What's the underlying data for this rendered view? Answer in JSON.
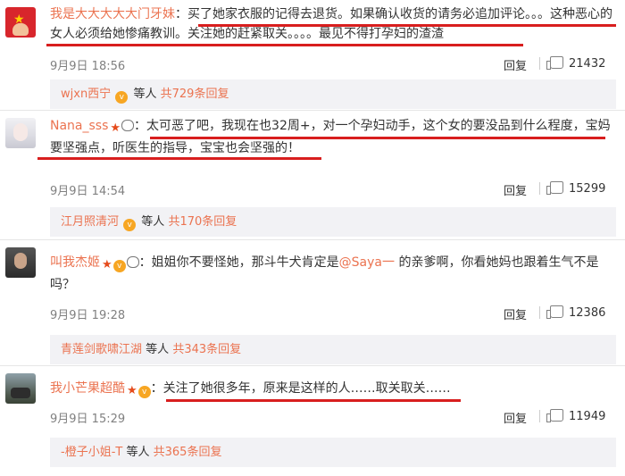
{
  "comments": [
    {
      "username": "我是大大大大大门牙妹",
      "separator": "：",
      "body": "买了她家衣服的记得去退货。如果确认收货的请务必追加评论。。。这种恶心的女人必须给她惨痛教训。关注她的赶紧取关。。。。最见不得打孕妇的渣渣",
      "date": "9月9日 18:56",
      "reply_label": "回复",
      "likes": "21432",
      "reply_preview": {
        "name": "wjxn西宁",
        "suffix": "等人",
        "more": "共729条回复"
      },
      "avatar_icon": "china-flag-avatar"
    },
    {
      "username": "Nana_sss",
      "separator": "：",
      "body": "太可恶了吧，我现在也32周+，对一个孕妇动手，这个女的要没品到什么程度，宝妈要坚强点，听医生的指导，宝宝也会坚强的！",
      "date": "9月9日 14:54",
      "reply_label": "回复",
      "likes": "15299",
      "reply_preview": {
        "name": "江月照清河",
        "suffix": "等人",
        "more": "共170条回复"
      },
      "avatar_icon": "girl-avatar"
    },
    {
      "username": "叫我杰姬",
      "separator": "：",
      "body_before": "姐姐你不要怪她，那斗牛犬肯定是",
      "mention": "@Saya一",
      "body_after": " 的亲爹啊，你看她妈也跟着生气不是吗？",
      "date": "9月9日 19:28",
      "reply_label": "回复",
      "likes": "12386",
      "reply_preview": {
        "name": "青莲剑歌啸江湖",
        "suffix": "等人",
        "more": "共343条回复"
      },
      "avatar_icon": "dark-portrait-avatar"
    },
    {
      "username": "我小芒果超酷",
      "separator": "：",
      "body": "关注了她很多年，原来是这样的人……取关取关……",
      "date": "9月9日 15:29",
      "reply_label": "回复",
      "likes": "11949",
      "reply_preview": {
        "name": "-橙子小姐-T",
        "suffix": "等人",
        "more": "共365条回复"
      },
      "avatar_icon": "landscape-avatar"
    }
  ],
  "colors": {
    "username": "#eb7350",
    "highlight_underline": "#d81e1e",
    "reply_box_bg": "#f2f2f5",
    "meta_text": "#808080"
  }
}
